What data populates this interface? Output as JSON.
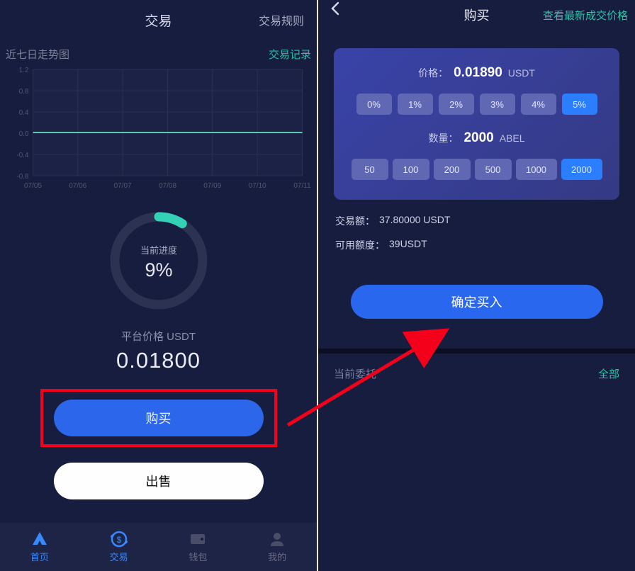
{
  "left": {
    "header": {
      "title": "交易",
      "rules": "交易规则"
    },
    "chart_header": {
      "trend": "近七日走势图",
      "records": "交易记录"
    },
    "progress": {
      "label": "当前进度",
      "value": "9%"
    },
    "price": {
      "label": "平台价格 USDT",
      "value": "0.01800"
    },
    "buttons": {
      "buy": "购买",
      "sell": "出售"
    },
    "nav": {
      "home": "首页",
      "trade": "交易",
      "wallet": "钱包",
      "mine": "我的"
    }
  },
  "right": {
    "header": {
      "title": "购买",
      "latest": "查看最新成交价格"
    },
    "card": {
      "price_key": "价格：",
      "price_value": "0.01890",
      "price_unit": "USDT",
      "pct_options": [
        "0%",
        "1%",
        "2%",
        "3%",
        "4%",
        "5%"
      ],
      "pct_selected": 5,
      "qty_key": "数量：",
      "qty_value": "2000",
      "qty_unit": "ABEL",
      "amt_options": [
        "50",
        "100",
        "200",
        "500",
        "1000",
        "2000"
      ],
      "amt_selected": 5
    },
    "info": {
      "trade_amount_key": "交易额：",
      "trade_amount_val": "37.80000 USDT",
      "avail_key": "可用额度：",
      "avail_val": "39USDT"
    },
    "confirm": "确定买入",
    "entrust": {
      "label": "当前委托",
      "all": "全部"
    }
  },
  "chart_data": {
    "type": "line",
    "x_labels": [
      "07/05",
      "07/06",
      "07/07",
      "07/08",
      "07/09",
      "07/10",
      "07/11"
    ],
    "y_ticks": [
      -0.8,
      -0.4,
      0.0,
      0.4,
      0.8,
      1.2
    ],
    "series": [
      {
        "name": "price",
        "values": [
          0.018,
          0.018,
          0.018,
          0.018,
          0.018,
          0.018,
          0.018
        ]
      }
    ],
    "title": "近七日走势图",
    "xlabel": "",
    "ylabel": "",
    "ylim": [
      -0.8,
      1.2
    ]
  },
  "colors": {
    "accent_green": "#2dbfa6",
    "accent_blue": "#2c66ea",
    "highlight_red": "#f5001b"
  }
}
